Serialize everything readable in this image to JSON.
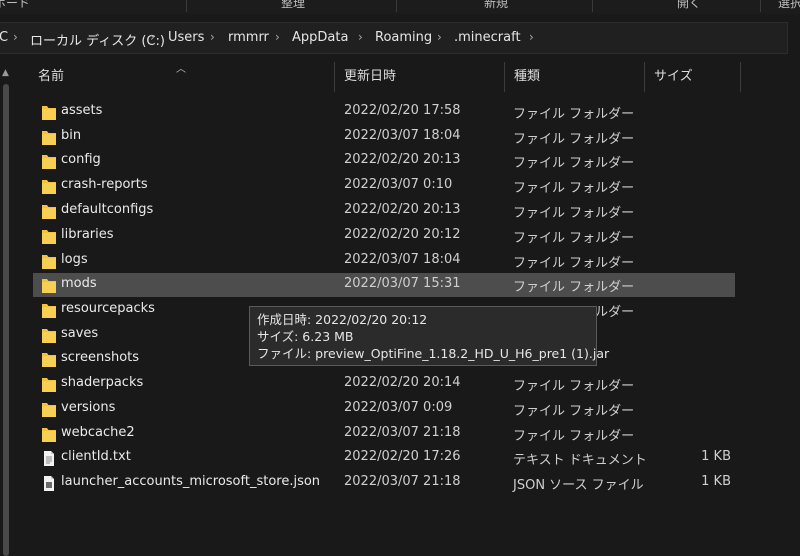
{
  "ribbon": {
    "groups": [
      "ボード",
      "整理",
      "新規",
      "開く",
      "選択"
    ]
  },
  "address": {
    "crumbs": [
      "C",
      "ローカル ディスク (C:)",
      "Users",
      "rmmrr",
      "AppData",
      "Roaming",
      ".minecraft"
    ]
  },
  "columns": {
    "name": "名前",
    "date": "更新日時",
    "type": "種類",
    "size": "サイズ"
  },
  "rows": [
    {
      "name": "assets",
      "date": "2022/02/20 17:58",
      "type": "ファイル フォルダー",
      "size": "",
      "icon": "folder-icon"
    },
    {
      "name": "bin",
      "date": "2022/03/07 18:04",
      "type": "ファイル フォルダー",
      "size": "",
      "icon": "folder-icon"
    },
    {
      "name": "config",
      "date": "2022/02/20 20:13",
      "type": "ファイル フォルダー",
      "size": "",
      "icon": "folder-icon"
    },
    {
      "name": "crash-reports",
      "date": "2022/03/07 0:10",
      "type": "ファイル フォルダー",
      "size": "",
      "icon": "folder-icon"
    },
    {
      "name": "defaultconfigs",
      "date": "2022/02/20 20:13",
      "type": "ファイル フォルダー",
      "size": "",
      "icon": "folder-icon"
    },
    {
      "name": "libraries",
      "date": "2022/02/20 20:12",
      "type": "ファイル フォルダー",
      "size": "",
      "icon": "folder-icon"
    },
    {
      "name": "logs",
      "date": "2022/03/07 18:04",
      "type": "ファイル フォルダー",
      "size": "",
      "icon": "folder-icon"
    },
    {
      "name": "mods",
      "date": "2022/03/07 15:31",
      "type": "ファイル フォルダー",
      "size": "",
      "icon": "folder-icon",
      "selected": true
    },
    {
      "name": "resourcepacks",
      "date": "",
      "type": "ファイル フォルダー",
      "size": "",
      "icon": "folder-icon"
    },
    {
      "name": "saves",
      "date": "",
      "type": "",
      "size": "",
      "icon": "folder-icon"
    },
    {
      "name": "screenshots",
      "date": "",
      "type": "",
      "size": "",
      "icon": "folder-icon"
    },
    {
      "name": "shaderpacks",
      "date": "2022/02/20 20:14",
      "type": "ファイル フォルダー",
      "size": "",
      "icon": "folder-icon"
    },
    {
      "name": "versions",
      "date": "2022/03/07 0:09",
      "type": "ファイル フォルダー",
      "size": "",
      "icon": "folder-icon"
    },
    {
      "name": "webcache2",
      "date": "2022/03/07 21:18",
      "type": "ファイル フォルダー",
      "size": "",
      "icon": "folder-icon"
    },
    {
      "name": "clientId.txt",
      "date": "2022/02/20 17:26",
      "type": "テキスト ドキュメント",
      "size": "1 KB",
      "icon": "text-file-icon"
    },
    {
      "name": "launcher_accounts_microsoft_store.json",
      "date": "2022/03/07 21:18",
      "type": "JSON ソース ファイル",
      "size": "1 KB",
      "icon": "json-file-icon"
    }
  ],
  "tooltip": {
    "created": "作成日時: 2022/02/20 20:12",
    "size": "サイズ: 6.23 MB",
    "file": "ファイル: preview_OptiFine_1.18.2_HD_U_H6_pre1 (1).jar"
  },
  "colors": {
    "background": "#191919",
    "selection": "#4d4d4d",
    "folder": "#f3c13a"
  }
}
